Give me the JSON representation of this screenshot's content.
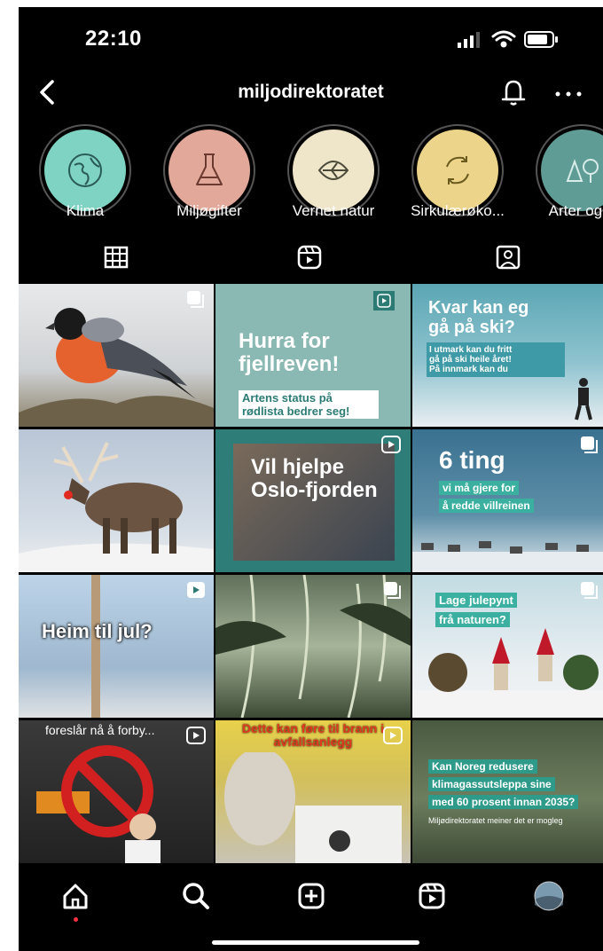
{
  "status_bar": {
    "time": "22:10"
  },
  "header": {
    "username": "miljodirektoratet"
  },
  "highlights": [
    {
      "label": "Klima",
      "color": "#7fd3c3",
      "icon": "earth-icon"
    },
    {
      "label": "Miljøgifter",
      "color": "#e2a89a",
      "icon": "flask-icon"
    },
    {
      "label": "Vernet natur",
      "color": "#efe5c8",
      "icon": "leaf-icon"
    },
    {
      "label": "Sirkulærøko...",
      "color": "#ecd48a",
      "icon": "cycle-icon"
    },
    {
      "label": "Arter og n",
      "color": "#5f9c96",
      "icon": "trees-icon"
    }
  ],
  "tabs": [
    "grid-icon",
    "reels-icon",
    "tagged-icon"
  ],
  "posts": [
    {
      "kind": "photo",
      "subject": "bullfinch-bird",
      "badge": "carousel-icon"
    },
    {
      "kind": "text",
      "title": "Hurra for fjellreven!",
      "subtitle": "Artens status på rødlista bedrer seg!",
      "badge": "reels-icon"
    },
    {
      "kind": "text",
      "title": "Kvar kan eg gå på ski?",
      "lines": [
        "I utmark kan du fritt",
        "gå på ski heile året!",
        "På innmark kan du"
      ],
      "badge": "none"
    },
    {
      "kind": "photo",
      "subject": "reindeer",
      "badge": "none"
    },
    {
      "kind": "text",
      "title": "Vil hjelpe Oslo-fjorden",
      "badge": "reels-icon"
    },
    {
      "kind": "text",
      "title": "6 ting",
      "tags": [
        "vi må gjere for",
        "å redde villreinen"
      ],
      "badge": "carousel-icon"
    },
    {
      "kind": "text",
      "title": "Heim til jul?",
      "badge": "reels-icon"
    },
    {
      "kind": "photo",
      "subject": "forest-lichen",
      "badge": "carousel-icon"
    },
    {
      "kind": "text",
      "tags": [
        "Lage julepynt",
        "frå naturen?"
      ],
      "badge": "carousel-icon"
    },
    {
      "kind": "text",
      "title": "foreslår nå å forby...",
      "badge": "reels-icon"
    },
    {
      "kind": "text",
      "title": "Dette kan føre til brann i avfallsanlegg",
      "badge": "reels-icon"
    },
    {
      "kind": "text",
      "tags": [
        "Kan Noreg redusere",
        "klimagassutsleppa sine",
        "med 60 prosent innan 2035?"
      ],
      "footer": "Miljødirektoratet meiner det er mogleg",
      "badge": "none"
    }
  ],
  "bottom_nav": [
    "home-icon",
    "search-icon",
    "create-icon",
    "reels-icon",
    "profile-avatar"
  ],
  "colors": {
    "background": "#000000",
    "accent_dot": "#ff3040",
    "teal": "#4aa0a0"
  }
}
